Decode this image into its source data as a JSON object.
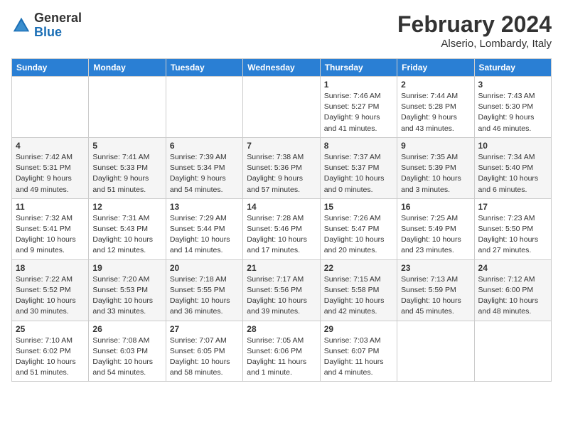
{
  "header": {
    "logo": {
      "general": "General",
      "blue": "Blue"
    },
    "title": "February 2024",
    "subtitle": "Alserio, Lombardy, Italy"
  },
  "calendar": {
    "days_of_week": [
      "Sunday",
      "Monday",
      "Tuesday",
      "Wednesday",
      "Thursday",
      "Friday",
      "Saturday"
    ],
    "weeks": [
      [
        {
          "day": "",
          "info": ""
        },
        {
          "day": "",
          "info": ""
        },
        {
          "day": "",
          "info": ""
        },
        {
          "day": "",
          "info": ""
        },
        {
          "day": "1",
          "info": "Sunrise: 7:46 AM\nSunset: 5:27 PM\nDaylight: 9 hours\nand 41 minutes."
        },
        {
          "day": "2",
          "info": "Sunrise: 7:44 AM\nSunset: 5:28 PM\nDaylight: 9 hours\nand 43 minutes."
        },
        {
          "day": "3",
          "info": "Sunrise: 7:43 AM\nSunset: 5:30 PM\nDaylight: 9 hours\nand 46 minutes."
        }
      ],
      [
        {
          "day": "4",
          "info": "Sunrise: 7:42 AM\nSunset: 5:31 PM\nDaylight: 9 hours\nand 49 minutes."
        },
        {
          "day": "5",
          "info": "Sunrise: 7:41 AM\nSunset: 5:33 PM\nDaylight: 9 hours\nand 51 minutes."
        },
        {
          "day": "6",
          "info": "Sunrise: 7:39 AM\nSunset: 5:34 PM\nDaylight: 9 hours\nand 54 minutes."
        },
        {
          "day": "7",
          "info": "Sunrise: 7:38 AM\nSunset: 5:36 PM\nDaylight: 9 hours\nand 57 minutes."
        },
        {
          "day": "8",
          "info": "Sunrise: 7:37 AM\nSunset: 5:37 PM\nDaylight: 10 hours\nand 0 minutes."
        },
        {
          "day": "9",
          "info": "Sunrise: 7:35 AM\nSunset: 5:39 PM\nDaylight: 10 hours\nand 3 minutes."
        },
        {
          "day": "10",
          "info": "Sunrise: 7:34 AM\nSunset: 5:40 PM\nDaylight: 10 hours\nand 6 minutes."
        }
      ],
      [
        {
          "day": "11",
          "info": "Sunrise: 7:32 AM\nSunset: 5:41 PM\nDaylight: 10 hours\nand 9 minutes."
        },
        {
          "day": "12",
          "info": "Sunrise: 7:31 AM\nSunset: 5:43 PM\nDaylight: 10 hours\nand 12 minutes."
        },
        {
          "day": "13",
          "info": "Sunrise: 7:29 AM\nSunset: 5:44 PM\nDaylight: 10 hours\nand 14 minutes."
        },
        {
          "day": "14",
          "info": "Sunrise: 7:28 AM\nSunset: 5:46 PM\nDaylight: 10 hours\nand 17 minutes."
        },
        {
          "day": "15",
          "info": "Sunrise: 7:26 AM\nSunset: 5:47 PM\nDaylight: 10 hours\nand 20 minutes."
        },
        {
          "day": "16",
          "info": "Sunrise: 7:25 AM\nSunset: 5:49 PM\nDaylight: 10 hours\nand 23 minutes."
        },
        {
          "day": "17",
          "info": "Sunrise: 7:23 AM\nSunset: 5:50 PM\nDaylight: 10 hours\nand 27 minutes."
        }
      ],
      [
        {
          "day": "18",
          "info": "Sunrise: 7:22 AM\nSunset: 5:52 PM\nDaylight: 10 hours\nand 30 minutes."
        },
        {
          "day": "19",
          "info": "Sunrise: 7:20 AM\nSunset: 5:53 PM\nDaylight: 10 hours\nand 33 minutes."
        },
        {
          "day": "20",
          "info": "Sunrise: 7:18 AM\nSunset: 5:55 PM\nDaylight: 10 hours\nand 36 minutes."
        },
        {
          "day": "21",
          "info": "Sunrise: 7:17 AM\nSunset: 5:56 PM\nDaylight: 10 hours\nand 39 minutes."
        },
        {
          "day": "22",
          "info": "Sunrise: 7:15 AM\nSunset: 5:58 PM\nDaylight: 10 hours\nand 42 minutes."
        },
        {
          "day": "23",
          "info": "Sunrise: 7:13 AM\nSunset: 5:59 PM\nDaylight: 10 hours\nand 45 minutes."
        },
        {
          "day": "24",
          "info": "Sunrise: 7:12 AM\nSunset: 6:00 PM\nDaylight: 10 hours\nand 48 minutes."
        }
      ],
      [
        {
          "day": "25",
          "info": "Sunrise: 7:10 AM\nSunset: 6:02 PM\nDaylight: 10 hours\nand 51 minutes."
        },
        {
          "day": "26",
          "info": "Sunrise: 7:08 AM\nSunset: 6:03 PM\nDaylight: 10 hours\nand 54 minutes."
        },
        {
          "day": "27",
          "info": "Sunrise: 7:07 AM\nSunset: 6:05 PM\nDaylight: 10 hours\nand 58 minutes."
        },
        {
          "day": "28",
          "info": "Sunrise: 7:05 AM\nSunset: 6:06 PM\nDaylight: 11 hours\nand 1 minute."
        },
        {
          "day": "29",
          "info": "Sunrise: 7:03 AM\nSunset: 6:07 PM\nDaylight: 11 hours\nand 4 minutes."
        },
        {
          "day": "",
          "info": ""
        },
        {
          "day": "",
          "info": ""
        }
      ]
    ]
  }
}
